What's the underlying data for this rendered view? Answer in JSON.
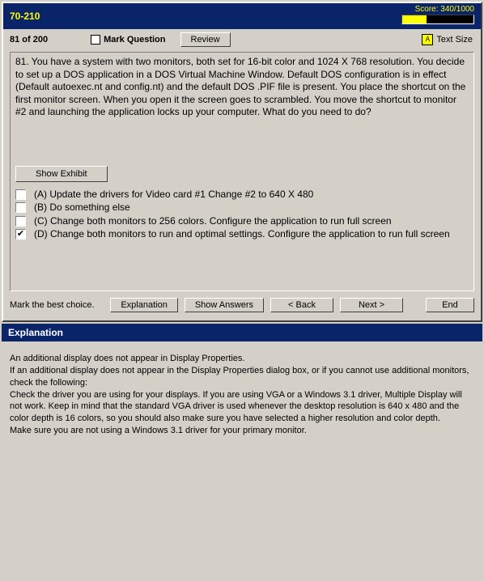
{
  "header": {
    "title": "70-210",
    "score_label": "Score: 340/1000",
    "progress_pct": 34
  },
  "toolbar": {
    "counter": "81 of 200",
    "mark_label": "Mark Question",
    "review_label": "Review",
    "text_size_label": "Text Size"
  },
  "question": {
    "text": "81.  You have a system with two monitors, both set for 16-bit color and 1024 X 768 resolution. You decide to set up a DOS application in a DOS Virtual Machine Window. Default DOS configuration is in effect (Default autoexec.nt and config.nt) and the default DOS .PIF file is present. You place the shortcut on the first monitor screen. When you open it the screen goes to scrambled. You move the shortcut to monitor #2 and launching the application locks up your computer. What do you need to do?",
    "show_exhibit_label": "Show Exhibit",
    "options": [
      {
        "letter": "(A)",
        "text": "Update the drivers for Video card #1 Change #2 to 640 X 480",
        "checked": false
      },
      {
        "letter": "(B)",
        "text": "Do something else",
        "checked": false
      },
      {
        "letter": "(C)",
        "text": "Change both monitors to 256 colors. Configure the application to run full screen",
        "checked": false
      },
      {
        "letter": "(D)",
        "text": "Change both monitors to run and optimal settings. Configure the application to run full screen",
        "checked": true
      }
    ]
  },
  "footer": {
    "instruction": "Mark the best choice.",
    "explanation_btn": "Explanation",
    "show_answers_btn": "Show Answers",
    "back_btn": "< Back",
    "next_btn": "Next >",
    "end_btn": "End"
  },
  "explanation": {
    "heading": "Explanation",
    "body": "An additional display does not appear in Display Properties.\nIf an additional display does not appear in the Display Properties dialog box, or if you cannot use additional monitors, check the following:\nCheck the driver you are using for your displays. If you are using VGA or a Windows 3.1 driver, Multiple Display will not work. Keep in mind that the standard VGA driver is used whenever the desktop resolution is 640 x 480 and the color depth is 16 colors, so you should also make sure you have selected a higher resolution and color depth.\nMake sure you are not using a Windows 3.1 driver for your primary monitor."
  }
}
